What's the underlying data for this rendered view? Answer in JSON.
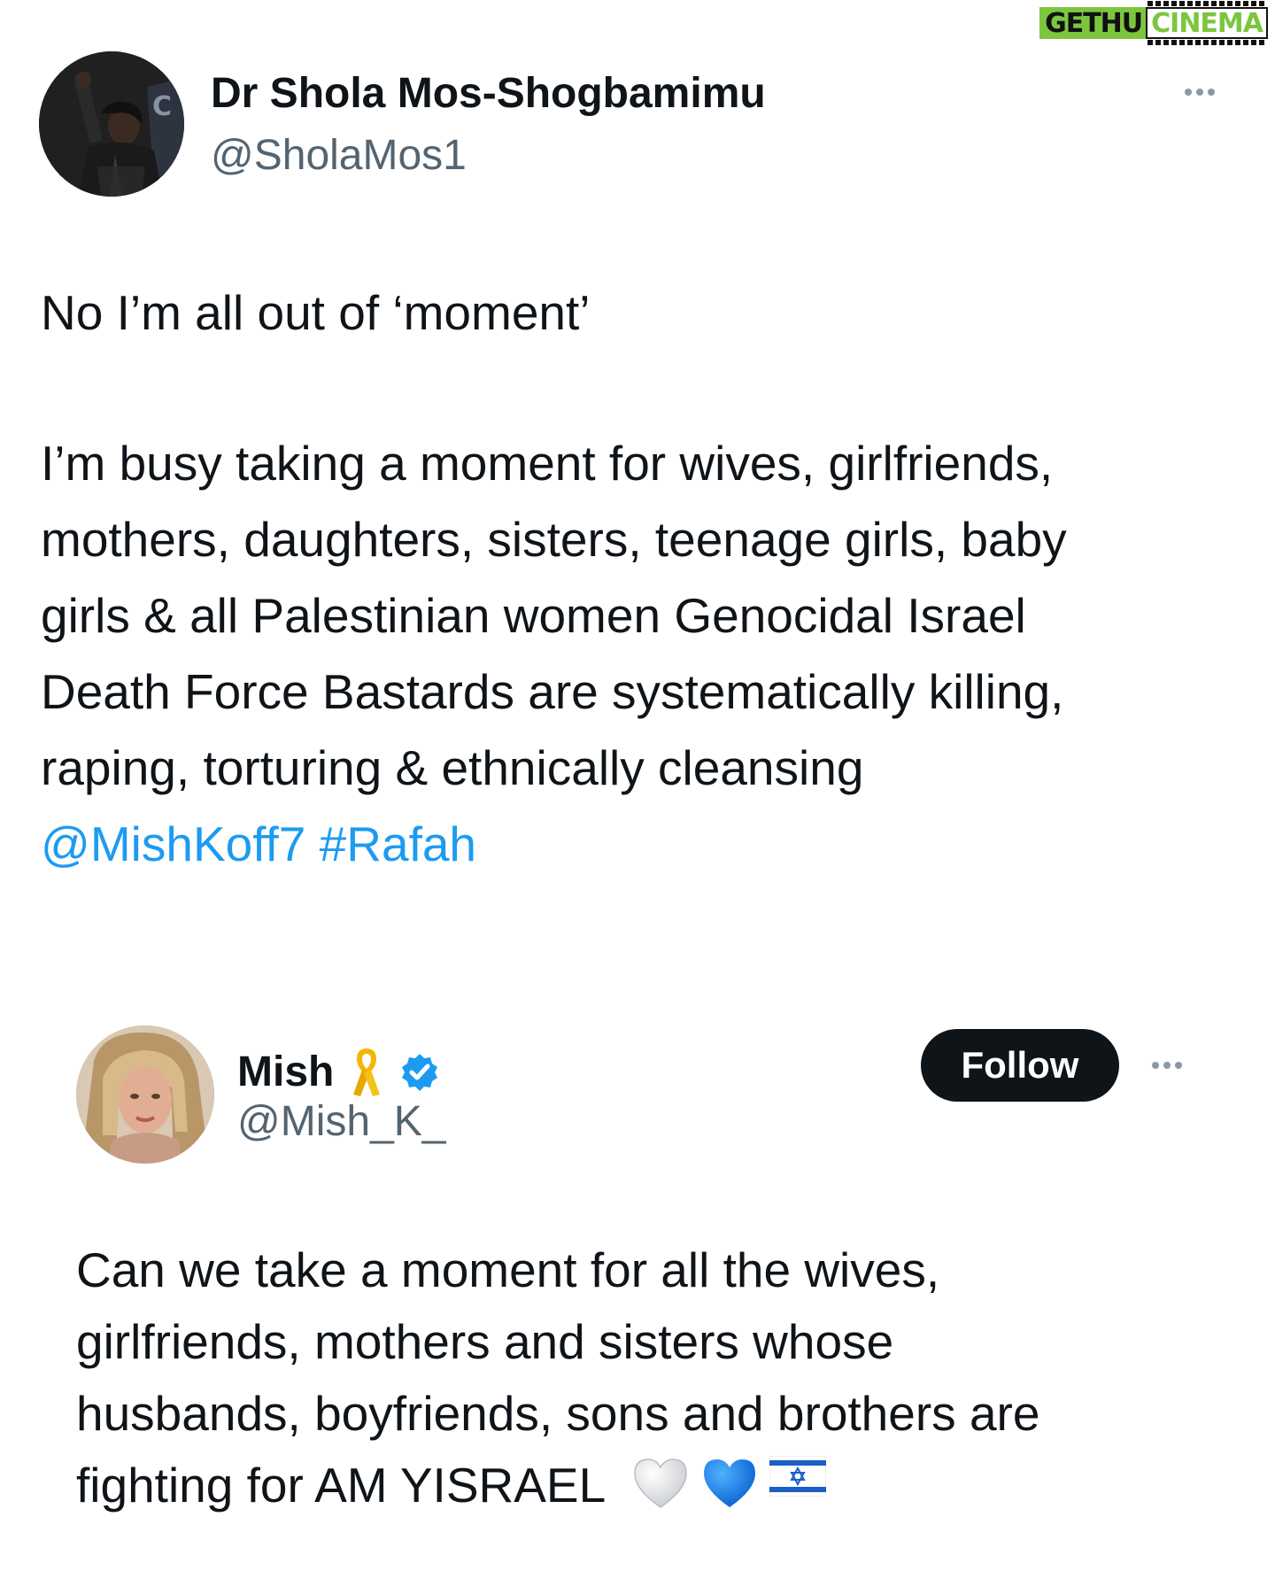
{
  "watermark": {
    "part_a": "GETHU",
    "part_b": "CINEMA"
  },
  "tweet": {
    "author_name": "Dr Shola Mos-Shogbamimu",
    "author_handle": "@SholaMos1",
    "line1": "No I’m all out of ‘moment’",
    "para2_lines": [
      "I’m busy taking a moment for wives, girlfriends,",
      "mothers, daughters, sisters, teenage girls, baby",
      "girls & all Palestinian women Genocidal Israel",
      "Death Force Bastards are systematically killing,",
      "raping, torturing & ethnically cleansing"
    ],
    "mention": "@MishKoff7",
    "hashtag": "#Rafah",
    "more_icon": "more-horizontal-icon"
  },
  "quoted_tweet": {
    "author_name": "Mish",
    "author_handle": "@Mish_K_",
    "follow_label": "Follow",
    "ribbon_icon": "yellow-ribbon-icon",
    "verified_icon": "verified-badge-icon",
    "more_icon": "more-horizontal-icon",
    "body_lines": [
      "Can we take a moment for all the wives,",
      "girlfriends, mothers and sisters whose",
      "husbands, boyfriends, sons and brothers are",
      "fighting for AM YISRAEL"
    ],
    "emojis": [
      "white-heart-icon",
      "blue-heart-icon",
      "israel-flag-icon"
    ]
  },
  "colors": {
    "link": "#1d9bf0",
    "text": "#0f1419",
    "secondary": "#536471",
    "follow_bg": "#0f1419",
    "verified": "#1d9bf0",
    "watermark": "#7cc63e"
  }
}
